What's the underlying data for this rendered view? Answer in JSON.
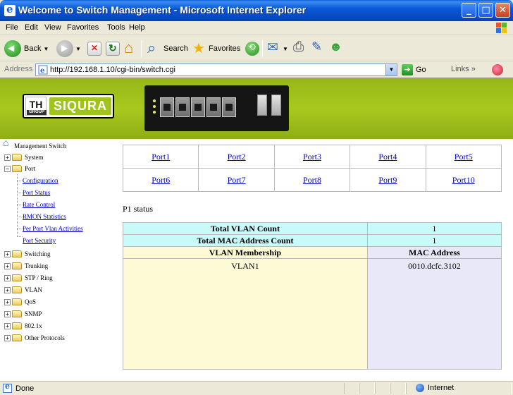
{
  "window": {
    "title": "Welcome to Switch Management - Microsoft Internet Explorer"
  },
  "menu": [
    {
      "label": "File",
      "u": "F"
    },
    {
      "label": "Edit",
      "u": "E"
    },
    {
      "label": "View",
      "u": "V"
    },
    {
      "label": "Favorites",
      "u": "a"
    },
    {
      "label": "Tools",
      "u": "T"
    },
    {
      "label": "Help",
      "u": "H"
    }
  ],
  "toolbar": {
    "back": "Back",
    "search": "Search",
    "favorites": "Favorites"
  },
  "address": {
    "label": "Address",
    "url": "http://192.168.1.10/cgi-bin/switch.cgi",
    "go": "Go",
    "links": "Links"
  },
  "banner": {
    "logo_th": "TH",
    "logo_group": "GROUP",
    "logo_siqura": "SIQURA"
  },
  "nav": {
    "root": "Management Switch",
    "system": "System",
    "port": "Port",
    "port_children": [
      "Configuration",
      "Port Status",
      "Rate Control",
      "RMON Statistics",
      "Per Port Vlan Activities",
      "Port Security"
    ],
    "others": [
      "Switching",
      "Trunking",
      "STP / Ring",
      "VLAN",
      "QoS",
      "SNMP",
      "802.1x",
      "Other Protocols"
    ]
  },
  "ports": {
    "row1": [
      "Port1",
      "Port2",
      "Port3",
      "Port4",
      "Port5"
    ],
    "row2": [
      "Port6",
      "Port7",
      "Port8",
      "Port9",
      "Port10"
    ]
  },
  "status": {
    "heading": "P1 status",
    "total_vlan_label": "Total VLAN Count",
    "total_vlan_value": "1",
    "total_mac_label": "Total MAC Address Count",
    "total_mac_value": "1",
    "vlan_header": "VLAN Membership",
    "mac_header": "MAC Address",
    "vlan_value": "VLAN1",
    "mac_value": "0010.dcfc.3102"
  },
  "statusbar": {
    "state": "Done",
    "zone": "Internet"
  },
  "colors": {
    "banner": "#a9c81f",
    "cyan_row": "#c8fafa",
    "cream_cell": "#fefad6",
    "lavender_cell": "#e8e8f8"
  }
}
